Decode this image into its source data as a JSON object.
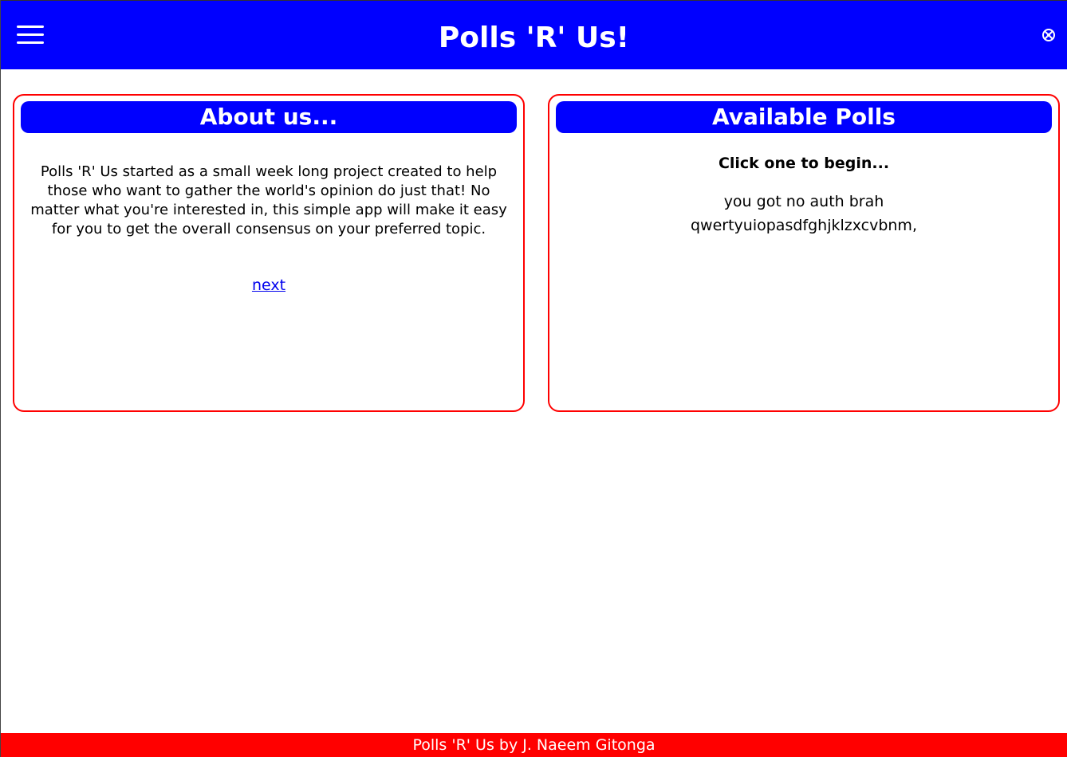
{
  "header": {
    "title": "Polls 'R' Us!",
    "menu_icon": "hamburger-menu-icon",
    "login_icon": "login-icon"
  },
  "about": {
    "heading": "About us...",
    "text": "Polls 'R' Us started as a small week long project created to help those who want to gather the world's opinion do just that! No matter what you're interested in, this simple app will make it easy for you to get the overall consensus on your preferred topic.",
    "next_link": "next"
  },
  "polls": {
    "heading": "Available Polls",
    "instruction": "Click one to begin...",
    "items": [
      "you got no auth brah",
      "qwertyuiopasdfghjklzxcvbnm,"
    ]
  },
  "footer": {
    "text": "Polls 'R' Us by J. Naeem Gitonga"
  },
  "colors": {
    "header_bg": "#0000ff",
    "panel_border": "#ff0000",
    "footer_bg": "#ff0000",
    "link": "#0000ee"
  }
}
